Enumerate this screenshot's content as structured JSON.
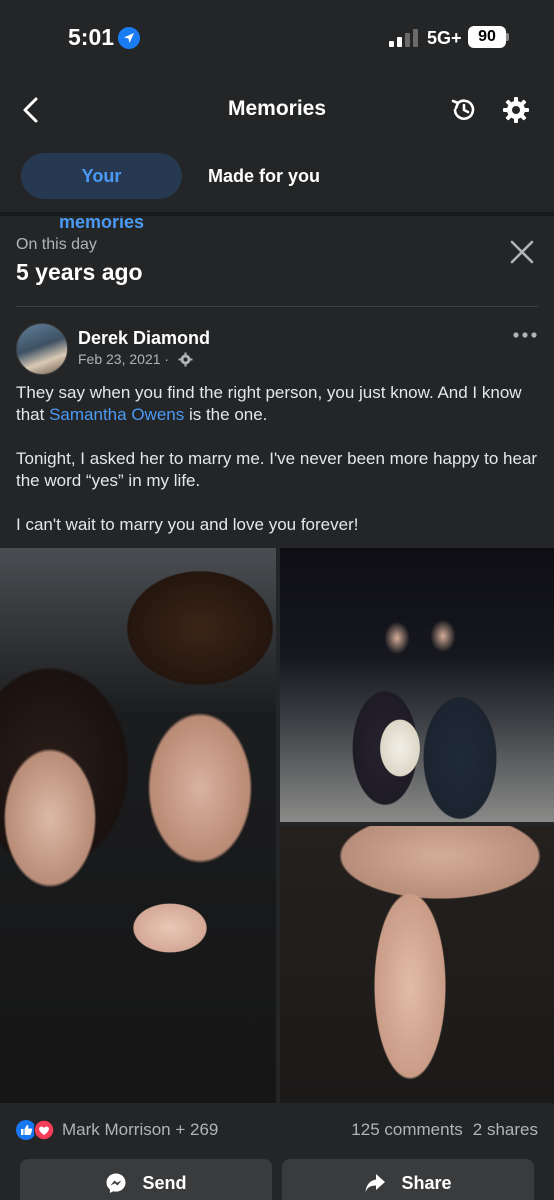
{
  "status_bar": {
    "time": "5:01",
    "network": "5G+",
    "battery": "90"
  },
  "header": {
    "title": "Memories"
  },
  "tabs": [
    {
      "label": "Your memories",
      "active": true
    },
    {
      "label": "Made for you",
      "active": false
    }
  ],
  "memory": {
    "label": "On this day",
    "title": "5 years ago"
  },
  "post": {
    "author": "Derek Diamond",
    "date": "Feb 23, 2021 ·",
    "paragraph_1_before": "They say when you find the right person, you just know. And I know that ",
    "mention": "Samantha Owens",
    "paragraph_1_after": " is the one.",
    "paragraph_2": "Tonight, I asked her to marry me. I've never been more happy to hear the word “yes” in my life.",
    "paragraph_3": "I can't wait to marry you and love you forever!"
  },
  "reactions": {
    "names": "Mark Morrison + 269",
    "comments": "125 comments",
    "shares": "2 shares"
  },
  "actions": {
    "send_label": "Send",
    "share_label": "Share"
  },
  "colors": {
    "accent": "#4a9af5",
    "background": "#242526",
    "button": "#3a3b3c"
  },
  "icons": [
    "back-icon",
    "history-icon",
    "gear-icon",
    "close-icon",
    "more-icon",
    "like-icon",
    "love-icon",
    "messenger-icon",
    "share-arrow-icon"
  ]
}
